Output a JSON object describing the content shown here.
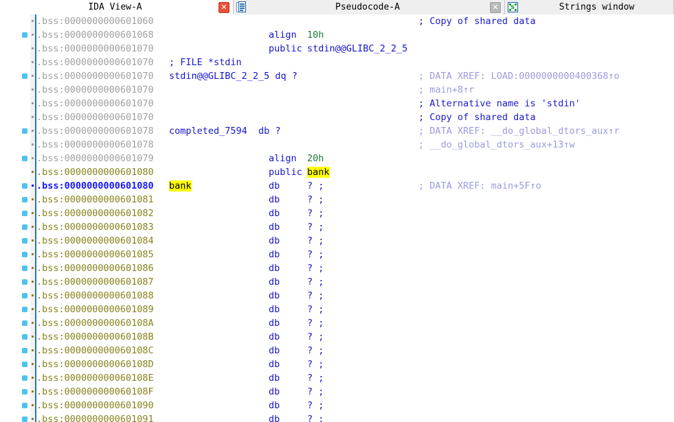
{
  "tabs": [
    {
      "label": "IDA View-A",
      "icon": "none",
      "close_icon": "close-icon-red",
      "active": true
    },
    {
      "label": "Pseudocode-A",
      "icon": "pseudocode-document-icon",
      "close_icon": "close-icon-gray",
      "active": false
    },
    {
      "label": "Strings window",
      "icon": "strings-window-icon",
      "close_icon": "none",
      "active": false
    }
  ],
  "colors": {
    "address_default": "#a0a0a0",
    "address_undefined": "#86831b",
    "address_current": "#1414ff",
    "keyword": "#1414d0",
    "number": "#1f7a3d",
    "comment": "#1a1acc",
    "xref": "#9a9ae0",
    "highlight_bg": "#ffff00",
    "gutter_line": "#2a6fb5",
    "breakpoint_dot": "#4cc3ef",
    "tab_underline": "#7b9fd4"
  },
  "disassembly": {
    "segment": ".bss",
    "lines": [
      {
        "addr": ".bss:0000000000601060",
        "addr_style": "default",
        "dot": false,
        "tick": "gray",
        "name": "",
        "mnemonic": "",
        "operand": "",
        "comment": "; Copy of shared data",
        "comment_style": "comment"
      },
      {
        "addr": ".bss:0000000000601068",
        "addr_style": "default",
        "dot": true,
        "tick": "gray",
        "name": "",
        "mnemonic": "align",
        "operand": "10h",
        "comment": "",
        "comment_style": "comment"
      },
      {
        "addr": ".bss:0000000000601070",
        "addr_style": "default",
        "dot": false,
        "tick": "gray",
        "name": "",
        "mnemonic": "public",
        "operand": "stdin@@GLIBC_2_2_5",
        "operand_style": "name",
        "comment": "",
        "comment_style": "comment"
      },
      {
        "addr": ".bss:0000000000601070",
        "addr_style": "default",
        "dot": false,
        "tick": "gray",
        "name": "; FILE *stdin",
        "name_style": "comment",
        "mnemonic": "",
        "operand": "",
        "comment": "",
        "comment_style": "comment"
      },
      {
        "addr": ".bss:0000000000601070",
        "addr_style": "default",
        "dot": true,
        "tick": "gray",
        "name": "stdin@@GLIBC_2_2_5 dq ?",
        "name_style": "name",
        "mnemonic": "",
        "operand": "",
        "comment": "; DATA XREF: LOAD:0000000000400368↑o",
        "comment_style": "xref"
      },
      {
        "addr": ".bss:0000000000601070",
        "addr_style": "default",
        "dot": false,
        "tick": "gray",
        "name": "",
        "mnemonic": "",
        "operand": "",
        "comment": "; main+8↑r",
        "comment_style": "xref"
      },
      {
        "addr": ".bss:0000000000601070",
        "addr_style": "default",
        "dot": false,
        "tick": "gray",
        "name": "",
        "mnemonic": "",
        "operand": "",
        "comment": "; Alternative name is 'stdin'",
        "comment_style": "comment"
      },
      {
        "addr": ".bss:0000000000601070",
        "addr_style": "default",
        "dot": false,
        "tick": "gray",
        "name": "",
        "mnemonic": "",
        "operand": "",
        "comment": "; Copy of shared data",
        "comment_style": "comment"
      },
      {
        "addr": ".bss:0000000000601078",
        "addr_style": "default",
        "dot": true,
        "tick": "gray",
        "name": "completed_7594  db ?",
        "name_style": "name",
        "mnemonic": "",
        "operand": "",
        "comment": "; DATA XREF: __do_global_dtors_aux↑r",
        "comment_style": "xref"
      },
      {
        "addr": ".bss:0000000000601078",
        "addr_style": "default",
        "dot": false,
        "tick": "gray",
        "name": "",
        "mnemonic": "",
        "operand": "",
        "comment": "; __do_global_dtors_aux+13↑w",
        "comment_style": "xref"
      },
      {
        "addr": ".bss:0000000000601079",
        "addr_style": "default",
        "dot": true,
        "tick": "gray",
        "name": "",
        "mnemonic": "align",
        "operand": "20h",
        "comment": "",
        "comment_style": "comment"
      },
      {
        "addr": ".bss:0000000000601080",
        "addr_style": "undefined",
        "dot": false,
        "tick": "olive",
        "name": "",
        "mnemonic": "public",
        "operand": "bank",
        "operand_highlight": true,
        "comment": "",
        "comment_style": "comment"
      },
      {
        "addr": ".bss:0000000000601080",
        "addr_style": "current",
        "dot": true,
        "tick": "blue",
        "name": "bank",
        "name_highlight": true,
        "caret": true,
        "mnemonic": "db",
        "operand": "? ;",
        "comment": "; DATA XREF: main+5F↑o",
        "comment_style": "xref"
      },
      {
        "addr": ".bss:0000000000601081",
        "addr_style": "undefined",
        "dot": true,
        "tick": "olive",
        "name": "",
        "mnemonic": "db",
        "operand": "? ;",
        "comment": ""
      },
      {
        "addr": ".bss:0000000000601082",
        "addr_style": "undefined",
        "dot": true,
        "tick": "olive",
        "name": "",
        "mnemonic": "db",
        "operand": "? ;",
        "comment": ""
      },
      {
        "addr": ".bss:0000000000601083",
        "addr_style": "undefined",
        "dot": true,
        "tick": "olive",
        "name": "",
        "mnemonic": "db",
        "operand": "? ;",
        "comment": ""
      },
      {
        "addr": ".bss:0000000000601084",
        "addr_style": "undefined",
        "dot": true,
        "tick": "olive",
        "name": "",
        "mnemonic": "db",
        "operand": "? ;",
        "comment": ""
      },
      {
        "addr": ".bss:0000000000601085",
        "addr_style": "undefined",
        "dot": true,
        "tick": "olive",
        "name": "",
        "mnemonic": "db",
        "operand": "? ;",
        "comment": ""
      },
      {
        "addr": ".bss:0000000000601086",
        "addr_style": "undefined",
        "dot": true,
        "tick": "olive",
        "name": "",
        "mnemonic": "db",
        "operand": "? ;",
        "comment": ""
      },
      {
        "addr": ".bss:0000000000601087",
        "addr_style": "undefined",
        "dot": true,
        "tick": "olive",
        "name": "",
        "mnemonic": "db",
        "operand": "? ;",
        "comment": ""
      },
      {
        "addr": ".bss:0000000000601088",
        "addr_style": "undefined",
        "dot": true,
        "tick": "olive",
        "name": "",
        "mnemonic": "db",
        "operand": "? ;",
        "comment": ""
      },
      {
        "addr": ".bss:0000000000601089",
        "addr_style": "undefined",
        "dot": true,
        "tick": "olive",
        "name": "",
        "mnemonic": "db",
        "operand": "? ;",
        "comment": ""
      },
      {
        "addr": ".bss:000000000060108A",
        "addr_style": "undefined",
        "dot": true,
        "tick": "olive",
        "name": "",
        "mnemonic": "db",
        "operand": "? ;",
        "comment": ""
      },
      {
        "addr": ".bss:000000000060108B",
        "addr_style": "undefined",
        "dot": true,
        "tick": "olive",
        "name": "",
        "mnemonic": "db",
        "operand": "? ;",
        "comment": ""
      },
      {
        "addr": ".bss:000000000060108C",
        "addr_style": "undefined",
        "dot": true,
        "tick": "olive",
        "name": "",
        "mnemonic": "db",
        "operand": "? ;",
        "comment": ""
      },
      {
        "addr": ".bss:000000000060108D",
        "addr_style": "undefined",
        "dot": true,
        "tick": "olive",
        "name": "",
        "mnemonic": "db",
        "operand": "? ;",
        "comment": ""
      },
      {
        "addr": ".bss:000000000060108E",
        "addr_style": "undefined",
        "dot": true,
        "tick": "olive",
        "name": "",
        "mnemonic": "db",
        "operand": "? ;",
        "comment": ""
      },
      {
        "addr": ".bss:000000000060108F",
        "addr_style": "undefined",
        "dot": true,
        "tick": "olive",
        "name": "",
        "mnemonic": "db",
        "operand": "? ;",
        "comment": ""
      },
      {
        "addr": ".bss:0000000000601090",
        "addr_style": "undefined",
        "dot": true,
        "tick": "olive",
        "name": "",
        "mnemonic": "db",
        "operand": "? ;",
        "comment": ""
      },
      {
        "addr": ".bss:0000000000601091",
        "addr_style": "undefined",
        "dot": true,
        "tick": "olive",
        "name": "",
        "mnemonic": "db",
        "operand": "? ;",
        "comment": ""
      }
    ]
  }
}
